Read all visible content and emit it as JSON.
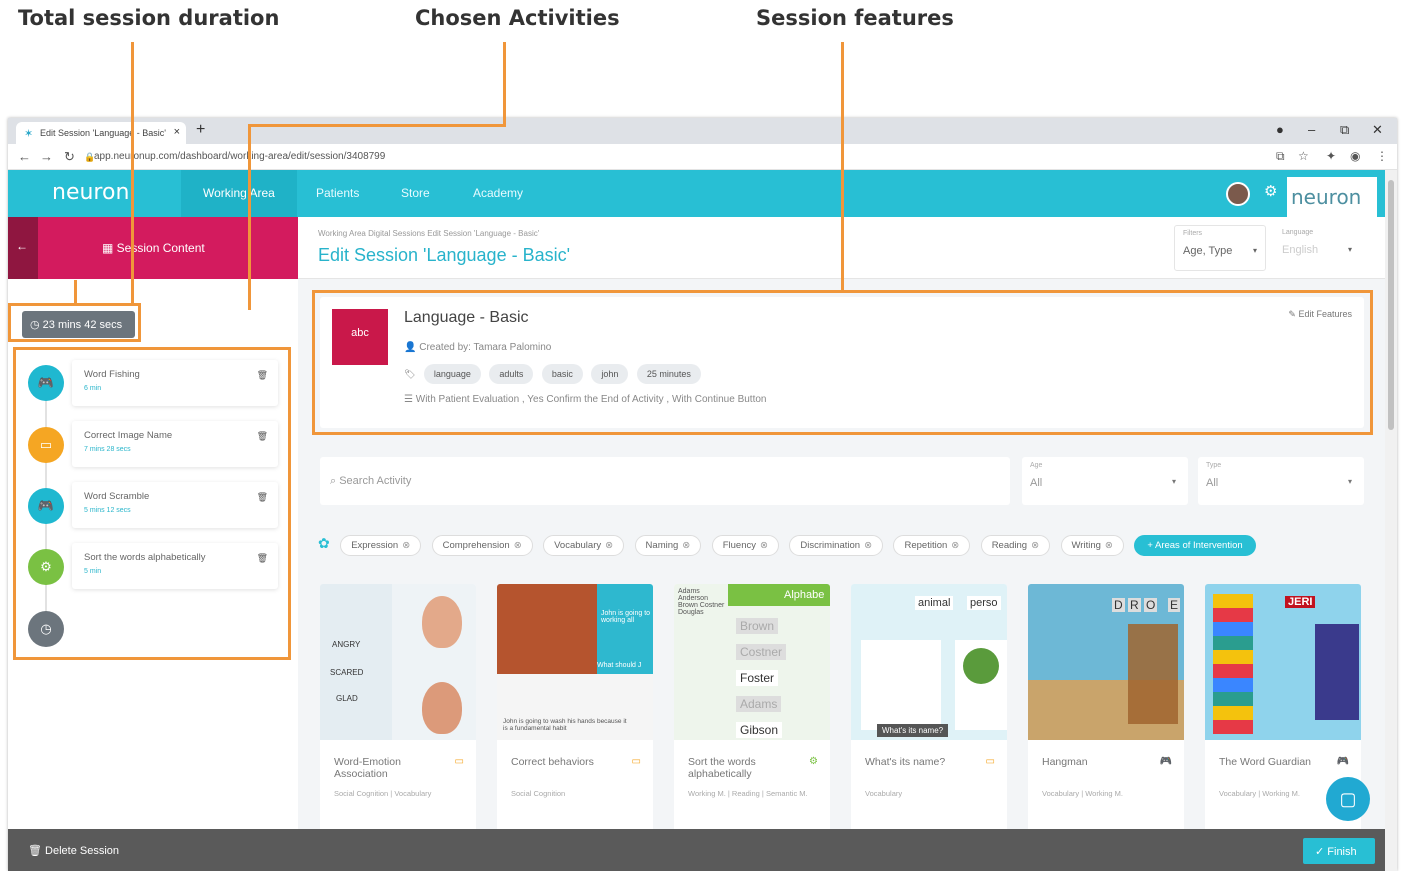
{
  "callouts": {
    "duration": "Total session duration",
    "activities": "Chosen Activities",
    "features": "Session features"
  },
  "browser": {
    "tab_title": "Edit Session 'Language - Basic'",
    "url": "app.neuronup.com/dashboard/working-area/edit/session/3408799"
  },
  "app": {
    "logo": "neuron",
    "nav": [
      "Working Area",
      "Patients",
      "Store",
      "Academy"
    ]
  },
  "sidebar": {
    "title": "Session Content",
    "duration": "23 mins 42 secs",
    "activities": [
      {
        "name": "Word Fishing",
        "duration": "6 min",
        "color": "#1fb8d0",
        "icon": "gamepad-icon"
      },
      {
        "name": "Correct Image Name",
        "duration": "7 mins 28 secs",
        "color": "#f5a623",
        "icon": "card-icon"
      },
      {
        "name": "Word Scramble",
        "duration": "5 mins 12 secs",
        "color": "#1fb8d0",
        "icon": "gamepad-icon"
      },
      {
        "name": "Sort the words alphabetically",
        "duration": "5 min",
        "color": "#7ac143",
        "icon": "gears-icon"
      }
    ]
  },
  "main": {
    "breadcrumb": "Working Area  Digital Sessions  Edit Session 'Language - Basic'",
    "title": "Edit Session 'Language - Basic'",
    "filters_label": "Filters",
    "filters_value": "Age, Type",
    "language_label": "Language",
    "language_value": "English",
    "session": {
      "name": "Language - Basic",
      "created_by": "Created by: Tamara Palomino",
      "edit": "Edit Features",
      "tags": [
        "language",
        "adults",
        "basic",
        "john",
        "25 minutes"
      ],
      "options": "With Patient Evaluation , Yes Confirm the End of Activity , With Continue Button"
    },
    "search_placeholder": "Search Activity",
    "age_label": "Age",
    "age_value": "All",
    "type_label": "Type",
    "type_value": "All",
    "chips": [
      "Expression",
      "Comprehension",
      "Vocabulary",
      "Naming",
      "Fluency",
      "Discrimination",
      "Repetition",
      "Reading",
      "Writing"
    ],
    "areas_button": "Areas of Intervention",
    "games": [
      {
        "name": "Word-Emotion Association",
        "cat": "Social Cognition | Vocabulary",
        "color": "#f5a623"
      },
      {
        "name": "Correct behaviors",
        "cat": "Social Cognition",
        "color": "#f5a623"
      },
      {
        "name": "Sort the words alphabetically",
        "cat": "Working M. | Reading | Semantic M.",
        "color": "#7ac143"
      },
      {
        "name": "What's its name?",
        "cat": "Vocabulary",
        "color": "#f5a623"
      },
      {
        "name": "Hangman",
        "cat": "Vocabulary | Working M.",
        "color": "#1fb8d0"
      },
      {
        "name": "The Word Guardian",
        "cat": "Vocabulary | Working M.",
        "color": "#1fb8d0"
      }
    ],
    "game_texts": {
      "emotions": [
        "ANGRY",
        "SCARED",
        "GLAD"
      ],
      "john1": "John is going to working all",
      "what_should": "What should J",
      "john2": "John is going to wash his hands because it is a fundamental habit",
      "names_list": "Adams Anderson Brown Costner Douglas",
      "alphabet": "Alphabe",
      "sorted": [
        "Brown",
        "Costner",
        "Foster",
        "Adams",
        "Gibson"
      ],
      "animal": "animal",
      "person": "perso",
      "whats_name": "What's its name?",
      "letters": [
        "D",
        "R",
        "O",
        "E"
      ],
      "jeri": "JERI"
    }
  },
  "footer": {
    "delete": "Delete Session",
    "finish": "Finish"
  }
}
